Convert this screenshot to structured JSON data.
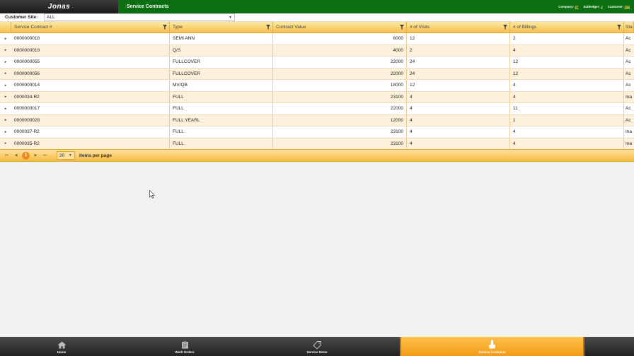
{
  "header": {
    "logo": "Jonas",
    "title": "Service Contracts",
    "company_label": "Company:",
    "company_value": "47",
    "subledger_label": "Subledger:",
    "subledger_value": "J",
    "customer_label": "Customer:",
    "customer_value": "334"
  },
  "filter": {
    "label": "Customer Site:",
    "value": "ALL"
  },
  "grid": {
    "columns": [
      "Service Contract #",
      "Type",
      "Contract Value",
      "# of Visits",
      "# of Billings",
      "Sta"
    ],
    "rows": [
      [
        "0000000018",
        "SEMI ANN",
        "6000",
        "12",
        "2",
        "Ac"
      ],
      [
        "0000000019",
        "Q/S",
        "4000",
        "2",
        "4",
        "Ac"
      ],
      [
        "0000000055",
        "FULLCOVER",
        "22000",
        "24",
        "12",
        "Ac"
      ],
      [
        "0000000056",
        "FULLCOVER",
        "22000",
        "24",
        "12",
        "Ac"
      ],
      [
        "0000000014",
        "MV/QB",
        "18000",
        "12",
        "4",
        "Ac"
      ],
      [
        "0000034-R2",
        "FULL",
        "23100",
        "4",
        "4",
        "Ina"
      ],
      [
        "0000000017",
        "FULL",
        "22000",
        "4",
        "11",
        "Ac"
      ],
      [
        "0000000028",
        "FULL YEARL",
        "12000",
        "4",
        "1",
        "Ac"
      ],
      [
        "0000037-R2",
        "FULL",
        "23100",
        "4",
        "4",
        "Ina"
      ],
      [
        "0000035-R2",
        "FULL",
        "23100",
        "4",
        "4",
        "Ina"
      ]
    ]
  },
  "pager": {
    "current_page": "1",
    "page_size": "20",
    "items_label": "items per page"
  },
  "nav": {
    "items": [
      {
        "label": "Home",
        "icon": "home-icon"
      },
      {
        "label": "Work Orders",
        "icon": "work-orders-icon"
      },
      {
        "label": "Service Items",
        "icon": "tag-icon"
      },
      {
        "label": "Service Contracts",
        "icon": "contract-hand-icon"
      }
    ]
  },
  "colors": {
    "header_green": "#0b6e12",
    "accent_orange": "#f5bb40",
    "active_nav": "#f29a17"
  }
}
